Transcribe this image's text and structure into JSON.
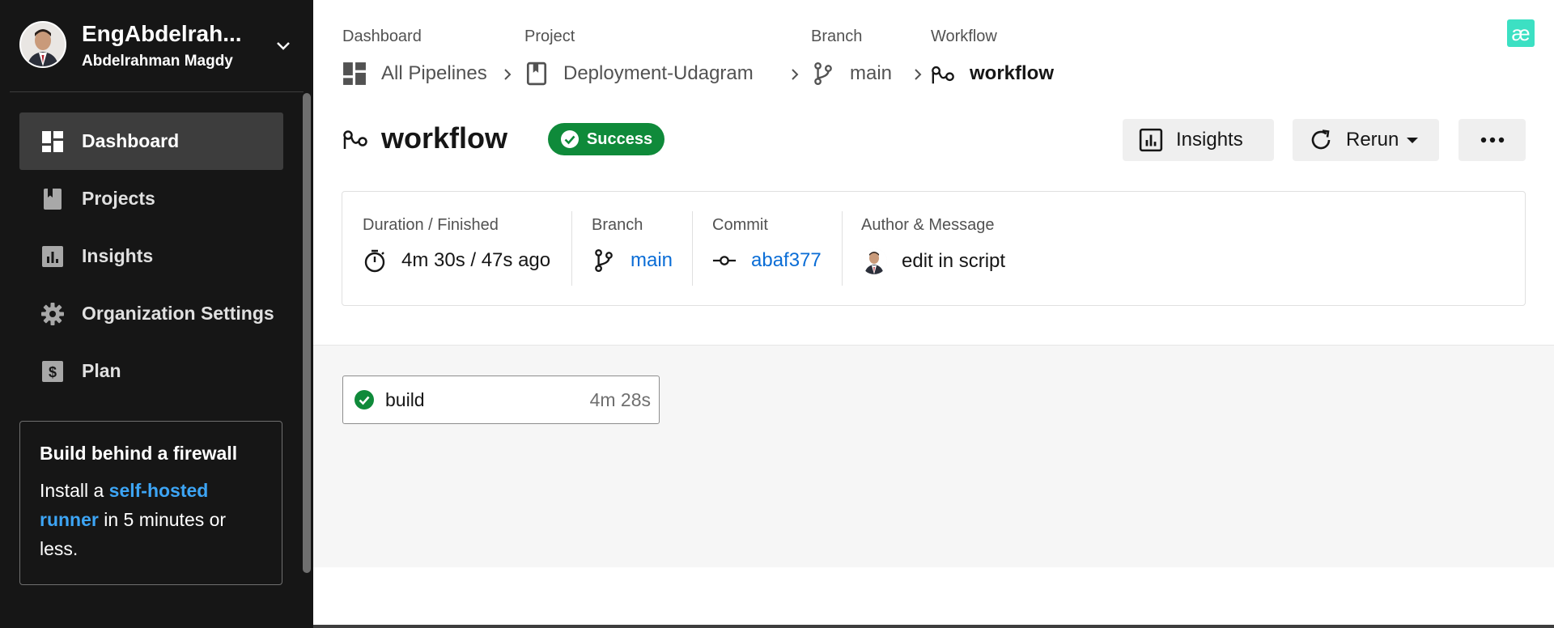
{
  "user": {
    "name": "EngAbdelrah...",
    "fullname": "Abdelrahman Magdy"
  },
  "sidebar": {
    "items": [
      {
        "label": "Dashboard",
        "icon": "dashboard-icon",
        "active": true
      },
      {
        "label": "Projects",
        "icon": "book-icon"
      },
      {
        "label": "Insights",
        "icon": "chart-icon"
      },
      {
        "label": "Organization Settings",
        "icon": "gear-icon"
      },
      {
        "label": "Plan",
        "icon": "dollar-icon"
      }
    ],
    "promo": {
      "title": "Build behind a firewall",
      "text_before": "Install a ",
      "link": "self-hosted runner",
      "text_after": " in 5 minutes or less."
    }
  },
  "breadcrumb": {
    "dashboard": {
      "caption": "Dashboard",
      "value": "All Pipelines"
    },
    "project": {
      "caption": "Project",
      "value": "Deployment-Udagram"
    },
    "branch": {
      "caption": "Branch",
      "value": "main"
    },
    "workflow": {
      "caption": "Workflow",
      "value": "workflow"
    }
  },
  "header": {
    "title": "workflow",
    "status": "Success",
    "insights_label": "Insights",
    "rerun_label": "Rerun"
  },
  "info": {
    "duration": {
      "caption": "Duration / Finished",
      "value": "4m 30s / 47s ago"
    },
    "branch": {
      "caption": "Branch",
      "value": "main"
    },
    "commit": {
      "caption": "Commit",
      "value": "abaf377"
    },
    "author": {
      "caption": "Author & Message",
      "value": "edit in script"
    }
  },
  "jobs": [
    {
      "name": "build",
      "duration": "4m 28s",
      "status": "success"
    }
  ],
  "logo_text": "æ",
  "colors": {
    "success": "#0f8a3a",
    "link": "#0a6dd6",
    "accent_link": "#3da5f5",
    "sidebar_bg": "#161616",
    "logo": "#3ce0c3"
  }
}
